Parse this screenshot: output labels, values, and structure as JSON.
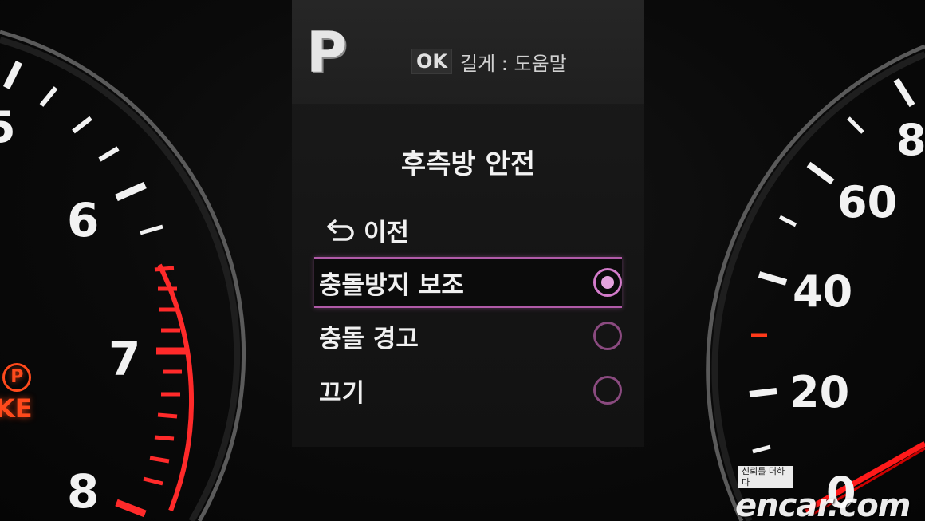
{
  "tachometer": {
    "numbers": [
      "6",
      "7",
      "8"
    ],
    "partial_number": "5"
  },
  "speedometer": {
    "numbers": [
      "60",
      "40",
      "20"
    ],
    "partial_numbers": [
      "8",
      "0"
    ]
  },
  "warning_light": {
    "symbol": "P",
    "text": "KE",
    "color": "#ff4a1c"
  },
  "display": {
    "gear": "P",
    "help_hint": {
      "key": "OK",
      "text": "길게 : 도움말"
    },
    "menu_title": "후측방 안전",
    "back_label": "이전",
    "options": [
      {
        "label": "충돌방지 보조",
        "selected": true
      },
      {
        "label": "충돌 경고",
        "selected": false
      },
      {
        "label": "끄기",
        "selected": false
      }
    ],
    "accent_color": "#b05aa8"
  },
  "watermark": {
    "tagline": "신뢰를 더하다",
    "brand": "encar.com"
  }
}
